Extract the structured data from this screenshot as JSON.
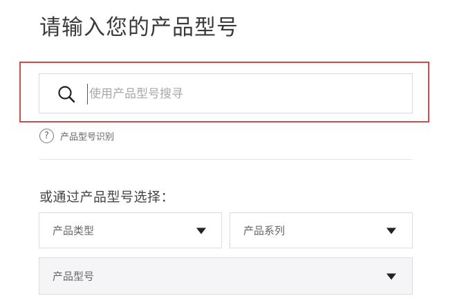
{
  "page": {
    "title": "请输入您的产品型号"
  },
  "search": {
    "placeholder": "使用产品型号搜寻",
    "value": ""
  },
  "help": {
    "icon_glyph": "?",
    "link_label": "产品型号识别"
  },
  "selection": {
    "section_label": "或通过产品型号选择：",
    "product_type": {
      "label": "产品类型"
    },
    "product_series": {
      "label": "产品系列"
    },
    "product_model": {
      "label": "产品型号"
    }
  },
  "colors": {
    "highlight_border": "#d34a4a",
    "field_border": "#d9d9d9",
    "disabled_bg": "#f5f5f7"
  },
  "icons": {
    "search": "search-icon",
    "help": "question-circle-icon",
    "dropdown": "caret-down-icon"
  }
}
